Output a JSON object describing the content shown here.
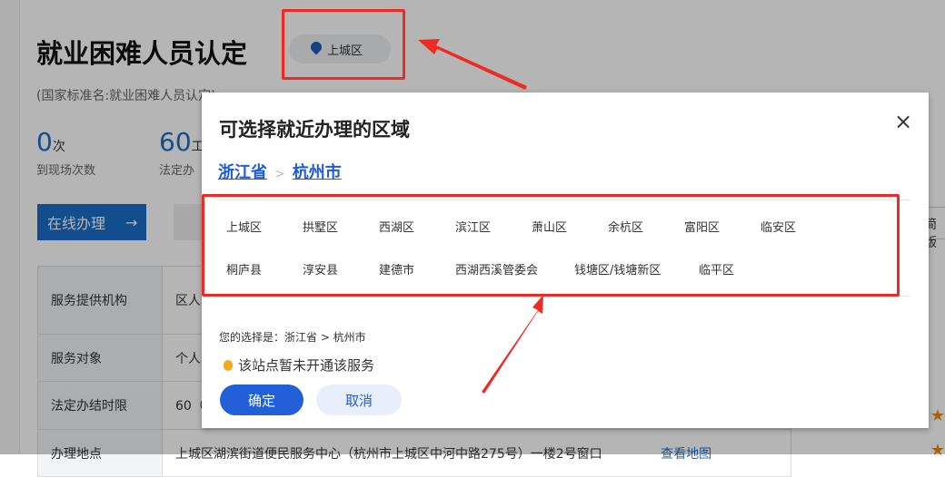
{
  "page": {
    "title": "就业困难人员认定",
    "location": "上城区",
    "subtitle": "(国家标准名:就业困难人员认定)",
    "stats": [
      {
        "num": "0",
        "unit": "次",
        "label": "到现场次数"
      },
      {
        "num": "60",
        "unit": "工",
        "label": "法定办"
      }
    ],
    "online_button": "在线办理",
    "online_arrow": "→",
    "simple_button": "简版",
    "rows": [
      {
        "key": "服务提供机构",
        "value": "区人"
      },
      {
        "key": "服务对象",
        "value": "个人"
      },
      {
        "key": "法定办结时限",
        "value": "60（"
      },
      {
        "key": "办理地点",
        "value": "上城区湖滨街道便民服务中心（杭州市上城区中河中路275号）一楼2号窗口",
        "link": "查看地图"
      }
    ]
  },
  "dialog": {
    "title": "可选择就近办理的区域",
    "close": "×",
    "province": "浙江省",
    "separator": ">",
    "city": "杭州市",
    "areas": [
      "上城区",
      "拱墅区",
      "西湖区",
      "滨江区",
      "萧山区",
      "余杭区",
      "富阳区",
      "临安区",
      "桐庐县",
      "淳安县",
      "建德市",
      "西湖西溪管委会",
      "钱塘区/钱塘新区",
      "临平区"
    ],
    "choice": "您的选择是：浙江省 > 杭州市",
    "warning": "该站点暂未开通该服务",
    "ok": "确定",
    "cancel": "取消"
  },
  "colors": {
    "accent": "#2160d8",
    "annotation": "#ee2a24",
    "warning": "#f5a623"
  }
}
